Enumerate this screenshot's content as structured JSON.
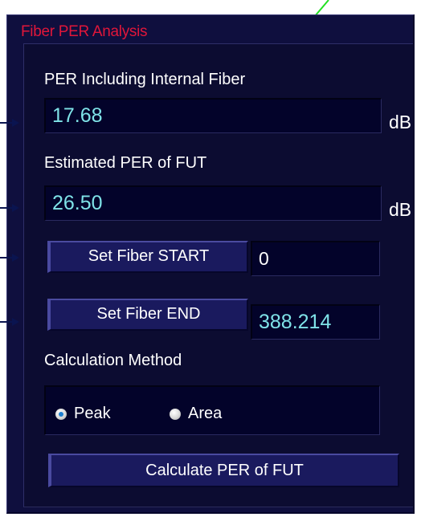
{
  "panel": {
    "title": "Fiber PER  Analysis"
  },
  "per_including": {
    "label": "PER Including  Internal Fiber",
    "value": "17.68",
    "unit": "dB"
  },
  "estimated_per": {
    "label": "Estimated PER of FUT",
    "value": "26.50",
    "unit": "dB"
  },
  "fiber_start": {
    "button_label": "Set Fiber START",
    "value": "0"
  },
  "fiber_end": {
    "button_label": "Set Fiber END",
    "value": "388.214"
  },
  "calculation": {
    "label": "Calculation Method",
    "options": [
      "Peak",
      "Area"
    ],
    "selected": "Peak"
  },
  "calculate_button_label": "Calculate  PER of  FUT",
  "colors": {
    "panel_bg": "#0f0f3e",
    "title": "#e0163a",
    "value_text": "#7fe3e8",
    "button_bg": "#1a1a5e",
    "annotation_arrow_green": "#22e022",
    "annotation_arrow_navy": "#0a1450"
  }
}
